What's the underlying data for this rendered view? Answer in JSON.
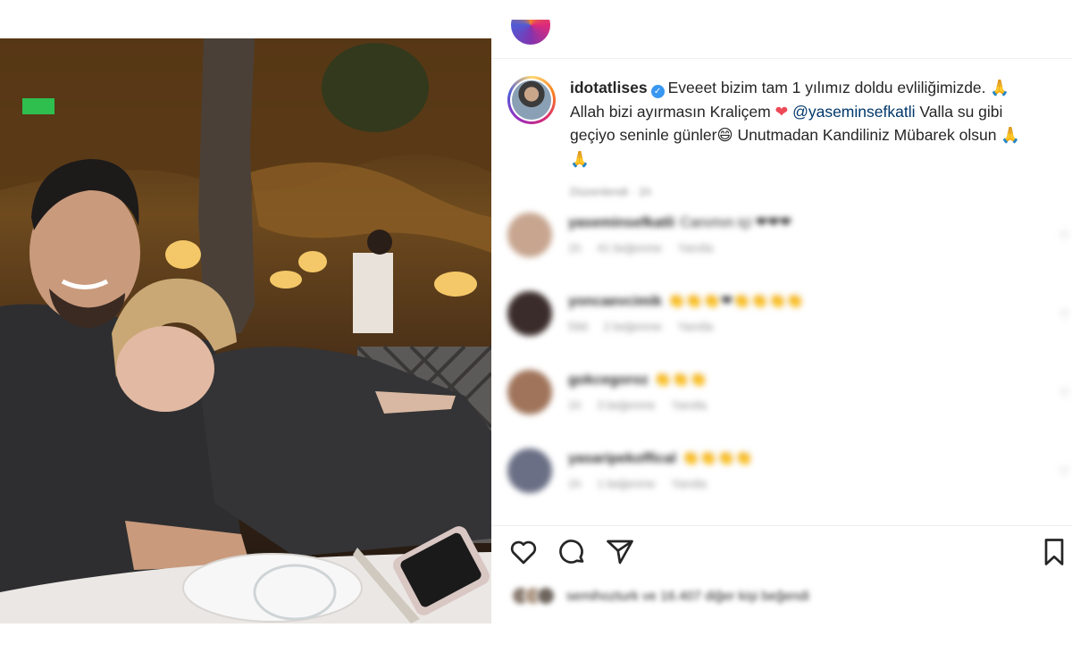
{
  "post": {
    "username": "idotatlises",
    "caption_part1": "Eveeet bizim tam 1 yılımız doldu evliliğimizde.",
    "caption_emoji1": "🙏",
    "caption_part2": "Allah bizi ayırmasın Kraliçem",
    "caption_heart": "❤",
    "mention": "@yaseminsefkatli",
    "caption_part3": "Valla su gibi geçiyo seninle günler",
    "caption_emoji2": "😄",
    "caption_part4": "Unutmadan Kandiliniz Mübarek olsun",
    "caption_emoji3": "🙏🙏",
    "timestamp": "Düzenlendi · 1h"
  },
  "comments": [
    {
      "user": "yaseminsefkatli",
      "text": "Canımın içi ❤❤❤",
      "time": "1h",
      "likes": "41 beğenme",
      "reply": "Yanıtla",
      "avatar_color": "#c7a58f"
    },
    {
      "user": "yoncaevcimik",
      "text": "👏👏👏❤👏👏👏👏",
      "time": "59d",
      "likes": "2 beğenme",
      "reply": "Yanıtla",
      "avatar_color": "#3a2c2a"
    },
    {
      "user": "gokcegoroz",
      "text": "👏👏👏",
      "time": "1h",
      "likes": "3 beğenme",
      "reply": "Yanıtla",
      "avatar_color": "#a0745a"
    },
    {
      "user": "yasaripekoffical",
      "text": "👏👏👏👏",
      "time": "1h",
      "likes": "1 beğenme",
      "reply": "Yanıtla",
      "avatar_color": "#6a6f85"
    }
  ],
  "like_summary": "semihozturk ve 16.407 diğer kişi beğendi",
  "colors": {
    "accent": "#3897f0",
    "mention": "#00376b",
    "heart": "#ed4956",
    "muted": "#8e8e8e"
  },
  "icons": {
    "like": "heart-outline-icon",
    "comment": "comment-bubble-icon",
    "share": "paper-plane-icon",
    "save": "bookmark-icon",
    "verified": "verified-badge-icon"
  }
}
